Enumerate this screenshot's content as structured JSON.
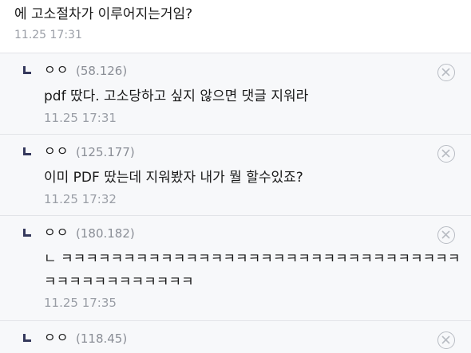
{
  "parent": {
    "text": "에 고소절차가 이루어지는거임?",
    "time": "11.25 17:31"
  },
  "replies": [
    {
      "author": "ㅇㅇ",
      "ip": "(58.126)",
      "text": "pdf 땄다. 고소당하고 싶지 않으면 댓글 지워라",
      "time": "11.25 17:31"
    },
    {
      "author": "ㅇㅇ",
      "ip": "(125.177)",
      "text": "이미 PDF 땄는데 지워봤자 내가 뭘 할수있죠?",
      "time": "11.25 17:32"
    },
    {
      "author": "ㅇㅇ",
      "ip": "(180.182)",
      "text": "ㄴ ㅋㅋㅋㅋㅋㅋㅋㅋㅋㅋㅋㅋㅋㅋㅋㅋㅋㅋㅋㅋㅋㅋㅋㅋㅋㅋㅋㅋㅋㅋㅋㅋㅋㅋㅋㅋㅋㅋㅋㅋㅋㅋㅋㅋ",
      "time": "11.25 17:35"
    },
    {
      "author": "ㅇㅇ",
      "ip": "(118.45)",
      "text": "",
      "time": ""
    }
  ],
  "icons": {
    "reply_arrow": "reply-arrow-icon",
    "delete": "delete-circle-x-icon"
  },
  "colors": {
    "reply_bg": "#f7f8fa",
    "divider": "#e2e4e8",
    "meta_text": "#9a9ea6",
    "arrow": "#35395c"
  }
}
